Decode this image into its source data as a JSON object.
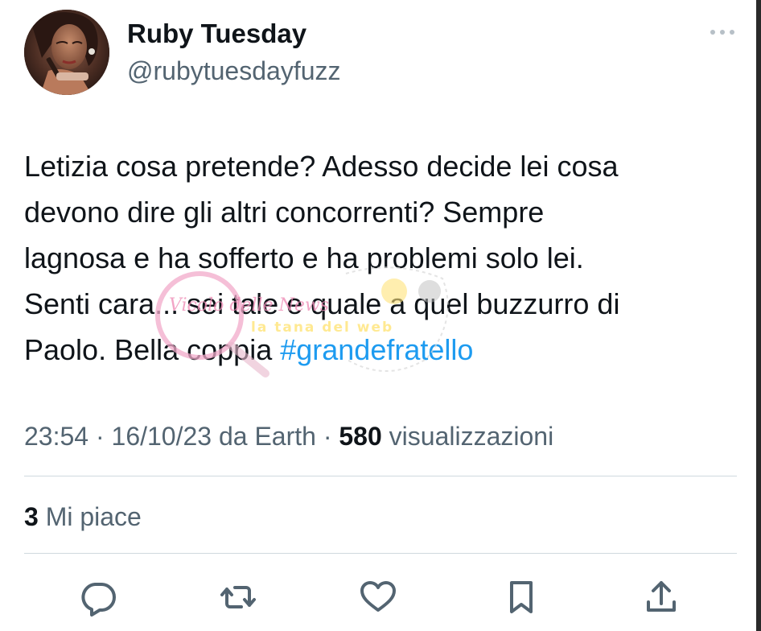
{
  "author": {
    "name": "Ruby Tuesday",
    "handle": "@rubytuesdayfuzz",
    "avatar_icon": "profile-photo"
  },
  "more_icon": "more-options-icon",
  "tweet": {
    "lines": [
      "Letizia cosa pretende? Adesso decide lei cosa",
      "devono dire gli altri concorrenti? Sempre",
      "lagnosa e ha sofferto e ha problemi solo lei.",
      "Senti cara... sei tale e quale a quel buzzurro di"
    ],
    "last_line_text": "Paolo. Bella coppia ",
    "hashtag": "#grandefratello"
  },
  "watermark": {
    "text_left": "Vicolo delle News",
    "text_right": "la tana del web"
  },
  "meta": {
    "time": "23:54",
    "date": "16/10/23",
    "source": "da Earth",
    "views_count": "580",
    "views_label": "visualizzazioni",
    "separator": "·"
  },
  "likes": {
    "count": "3",
    "label": "Mi piace"
  },
  "actions": [
    {
      "icon": "reply-icon"
    },
    {
      "icon": "retweet-icon"
    },
    {
      "icon": "like-icon"
    },
    {
      "icon": "bookmark-icon"
    },
    {
      "icon": "share-icon"
    }
  ],
  "colors": {
    "text": "#0f1419",
    "secondary": "#536471",
    "link": "#1d9bf0",
    "divider": "#cfd9de",
    "icon": "#536471"
  }
}
